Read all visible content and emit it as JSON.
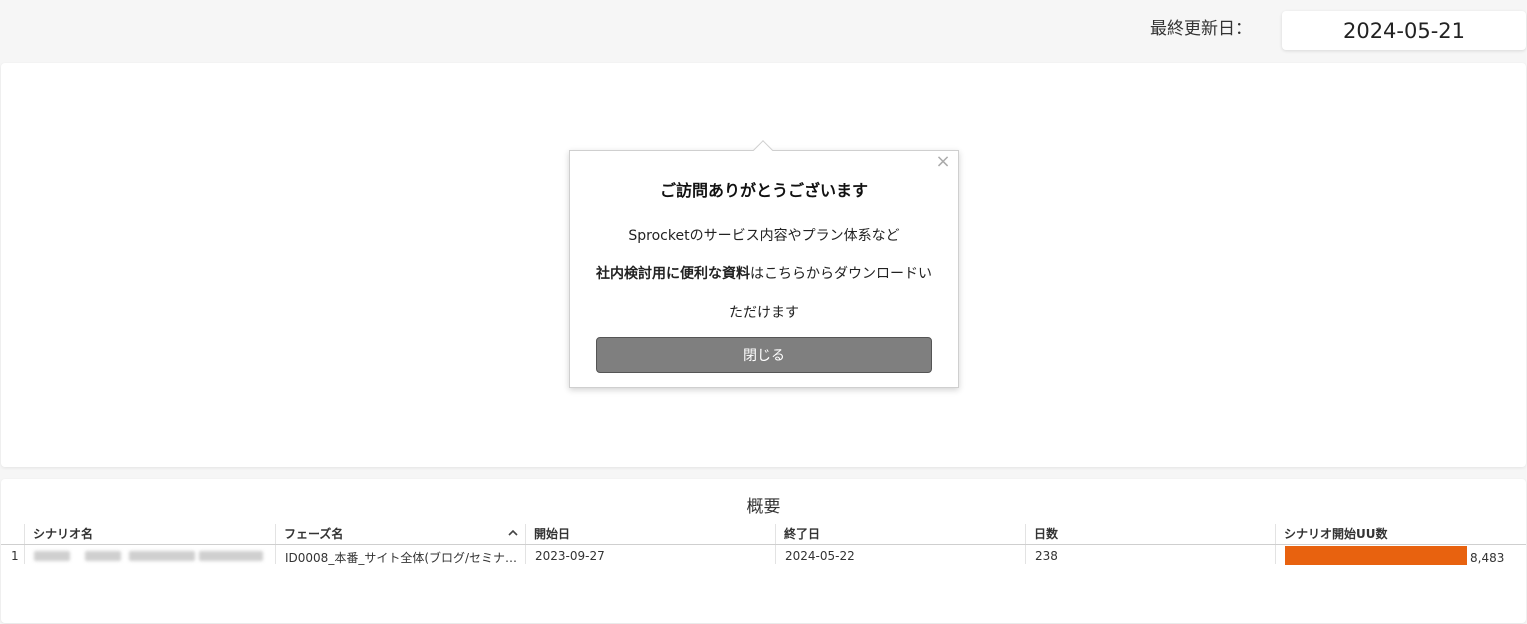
{
  "header": {
    "updated_label": "最終更新日：",
    "updated_date": "2024-05-21"
  },
  "popup": {
    "title": "ご訪問ありがとうございます",
    "line1": "Sprocketのサービス内容やプラン体系など",
    "line2_bold": "社内検討用に便利な資料",
    "line2_rest": "はこちらからダウンロードい",
    "line3": "ただけます",
    "close_button": "閉じる",
    "close_icon": "×"
  },
  "table": {
    "title": "概要",
    "columns": [
      "シナリオ名",
      "フェーズ名",
      "開始日",
      "終了日",
      "日数",
      "シナリオ開始UU数"
    ],
    "rows": [
      {
        "index": "1",
        "scenario": "",
        "phase": "ID0008_本番_サイト全体(ブログ/セミナ…",
        "start": "2023-09-27",
        "end": "2024-05-22",
        "days": "238",
        "uu": "8,483",
        "uu_fraction": 1.0
      }
    ],
    "bar_color": "#e8620f",
    "sort_icon": "chevron-up-icon"
  }
}
